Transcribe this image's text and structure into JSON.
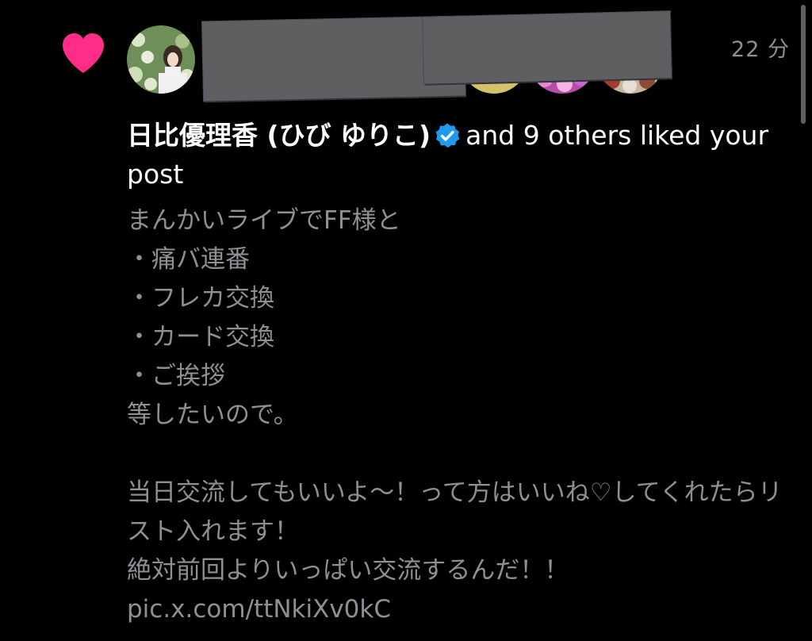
{
  "notification": {
    "type": "like",
    "icon": "heart-icon",
    "heart_color": "#ff2d87",
    "timestamp": "22 分",
    "liker_name": "日比優理香 (ひび ゆりこ)",
    "verified_badge": "verified-badge-icon",
    "verified_color": "#1d9bf0",
    "summary_text": "and 9 others liked your post",
    "avatars": [
      {
        "name": "avatar-1"
      },
      {
        "name": "avatar-2"
      },
      {
        "name": "avatar-3"
      },
      {
        "name": "avatar-4"
      },
      {
        "name": "avatar-5"
      },
      {
        "name": "avatar-6"
      },
      {
        "name": "avatar-7"
      }
    ],
    "post_text": "まんかいライブでFF様と\n・痛バ連番\n・フレカ交換\n・カード交換\n・ご挨拶\n等したいので。\n\n当日交流してもいいよ〜！って方はいいね♡してくれたらリスト入れます！\n絶対前回よりいっぱい交流するんだ！！ pic.x.com/ttNkiXv0kC"
  }
}
